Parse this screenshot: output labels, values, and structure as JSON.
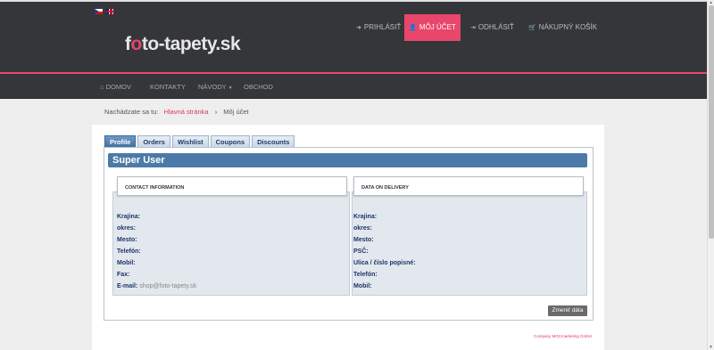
{
  "header": {
    "flags": [
      {
        "name": "cz-flag-icon"
      },
      {
        "name": "uk-flag-icon"
      }
    ],
    "logo": {
      "part1": "f",
      "part2": "o",
      "part3": "to-tapety.sk"
    },
    "topnav": {
      "login": {
        "icon": "login-icon",
        "label": "PRIHLÁSIŤ"
      },
      "account": {
        "icon": "user-icon",
        "label": "MÔJ ÚČET"
      },
      "logout": {
        "icon": "logout-icon",
        "label": "ODHLÁSIŤ"
      },
      "cart": {
        "icon": "cart-icon",
        "label": "NÁKUPNÝ KOŠÍK"
      }
    },
    "mainnav": {
      "home": {
        "icon": "home-icon",
        "label": "DOMOV"
      },
      "contacts": {
        "label": "KONTAKTY"
      },
      "guides": {
        "label": "NÁVODY",
        "icon": "caret-down-icon"
      },
      "shop": {
        "label": "OBCHOD"
      }
    }
  },
  "breadcrumb": {
    "prefix": "Nachádzate sa tu:",
    "home": "Hlavná stránka",
    "current": "Môj účet"
  },
  "tabs": [
    "Profile",
    "Orders",
    "Wishlist",
    "Coupons",
    "Discounts"
  ],
  "profile": {
    "user_name": "Super User",
    "contact": {
      "heading": "CONTACT INFORMATION",
      "fields": [
        {
          "label": "Krajina:",
          "value": ""
        },
        {
          "label": "okres:",
          "value": ""
        },
        {
          "label": "Mesto:",
          "value": ""
        },
        {
          "label": "Telefón:",
          "value": ""
        },
        {
          "label": "Mobil:",
          "value": ""
        },
        {
          "label": "Fax:",
          "value": ""
        },
        {
          "label": "E-mail:",
          "value": "shop@foto-tapety.sk"
        }
      ]
    },
    "delivery": {
      "heading": "DATA ON DELIVERY",
      "fields": [
        {
          "label": "Krajina:",
          "value": ""
        },
        {
          "label": "okres:",
          "value": ""
        },
        {
          "label": "Mesto:",
          "value": ""
        },
        {
          "label": "PSČ:",
          "value": ""
        },
        {
          "label": "Ulica / číslo popisné:",
          "value": ""
        },
        {
          "label": "Telefón:",
          "value": ""
        },
        {
          "label": "Mobil:",
          "value": ""
        }
      ]
    },
    "change_button": "Zmeniť dáta"
  },
  "footer": {
    "note": "Company MGCmarketing GmbH"
  },
  "colors": {
    "accent": "#e8466a",
    "header_bg": "#34363a",
    "title_bar": "#4c7aa8"
  }
}
